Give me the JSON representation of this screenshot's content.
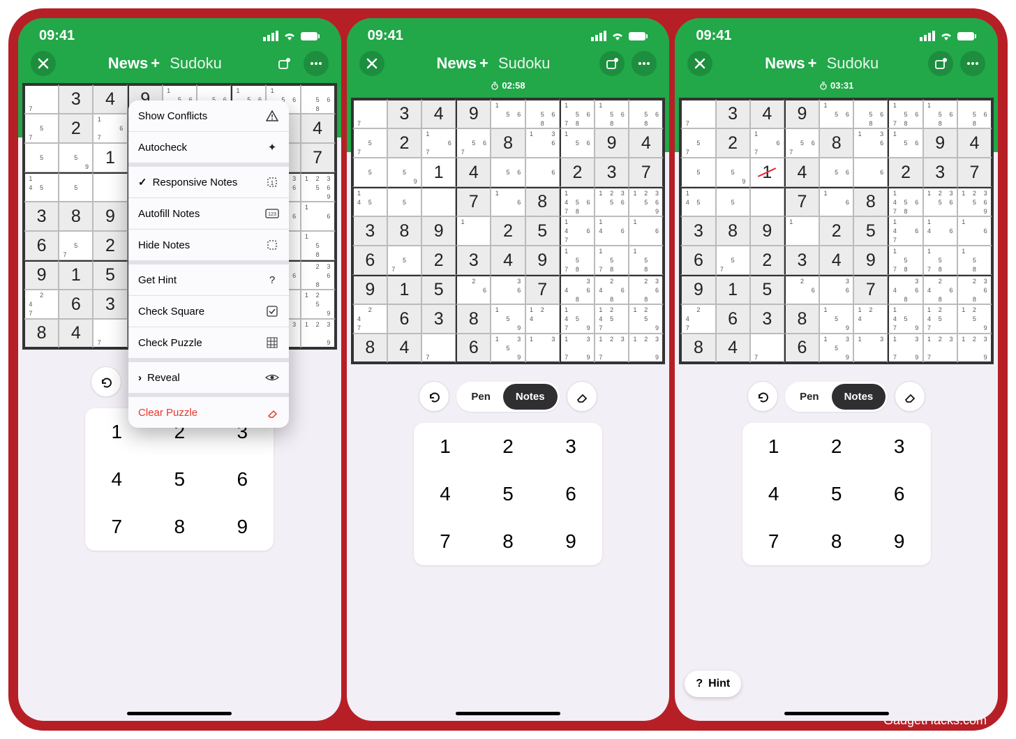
{
  "watermark": "GadgetHacks.com",
  "statusbar": {
    "time": "09:41"
  },
  "app_title": {
    "logo": "",
    "brand": "News",
    "plus": "+",
    "sub": "Sudoku"
  },
  "timers": {
    "s2": "02:58",
    "s3": "03:31"
  },
  "menu": {
    "show_conflicts": "Show Conflicts",
    "autocheck": "Autocheck",
    "responsive_notes": "Responsive Notes",
    "autofill_notes": "Autofill Notes",
    "hide_notes": "Hide Notes",
    "get_hint": "Get Hint",
    "check_square": "Check Square",
    "check_puzzle": "Check Puzzle",
    "reveal": "Reveal",
    "clear_puzzle": "Clear Puzzle"
  },
  "tools": {
    "pen": "Pen",
    "notes": "Notes"
  },
  "hint": {
    "label": "Hint",
    "icon": "?"
  },
  "keypad": [
    "1",
    "2",
    "3",
    "4",
    "5",
    "6",
    "7",
    "8",
    "9"
  ],
  "sudoku": {
    "comment": "Shared puzzle state across all three screenshots. v=given/entered value, g=grey(given), n=pencil notes list",
    "grid": [
      [
        {
          "n": [
            7
          ]
        },
        {
          "v": "3",
          "g": 1
        },
        {
          "v": "4",
          "g": 1
        },
        {
          "v": "9",
          "g": 1
        },
        {
          "n": [
            1,
            5,
            6
          ],
          "tr": [
            5,
            6
          ]
        },
        {
          "n": [
            8,
            5,
            6
          ]
        },
        {
          "n": [
            1,
            5,
            6,
            7,
            8
          ]
        },
        {
          "n": [
            1,
            5,
            6,
            8
          ]
        },
        {
          "n": [
            5,
            6,
            8
          ]
        }
      ],
      [
        {
          "n": [
            5,
            7
          ]
        },
        {
          "v": "2",
          "g": 1
        },
        {
          "n": [
            1,
            6,
            7
          ]
        },
        {
          "n": [
            5,
            6,
            7
          ]
        },
        {
          "v": "8",
          "g": 1
        },
        {
          "n": [
            1,
            3,
            6
          ]
        },
        {
          "n": [
            1,
            5,
            6
          ]
        },
        {
          "v": "9",
          "g": 1
        },
        {
          "v": "4",
          "g": 1
        }
      ],
      [
        {
          "n": [
            5
          ]
        },
        {
          "n": [
            5,
            9
          ]
        },
        {
          "v": "1",
          "redx_in_s3": true
        },
        {
          "v": "4",
          "g": 1
        },
        {
          "n": [
            5,
            6
          ]
        },
        {
          "n": [
            6
          ]
        },
        {
          "v": "2",
          "g": 1
        },
        {
          "v": "3",
          "g": 1
        },
        {
          "v": "7",
          "g": 1
        }
      ],
      [
        {
          "n": [
            1,
            4,
            5
          ]
        },
        {
          "n": [
            5
          ]
        },
        {
          "n": []
        },
        {
          "v": "7",
          "g": 1
        },
        {
          "n": [
            1,
            6
          ]
        },
        {
          "v": "8",
          "g": 1
        },
        {
          "n": [
            1,
            4,
            5,
            6,
            7,
            8
          ]
        },
        {
          "n": [
            1,
            2,
            3,
            5,
            6
          ]
        },
        {
          "n": [
            1,
            2,
            3,
            5,
            6,
            9
          ]
        }
      ],
      [
        {
          "v": "3",
          "g": 1
        },
        {
          "v": "8",
          "g": 1
        },
        {
          "v": "9",
          "g": 1
        },
        {
          "n": [
            1
          ]
        },
        {
          "v": "2",
          "g": 1
        },
        {
          "v": "5",
          "g": 1
        },
        {
          "n": [
            1,
            4,
            6,
            7
          ]
        },
        {
          "n": [
            1,
            4,
            6
          ]
        },
        {
          "n": [
            1,
            6
          ]
        }
      ],
      [
        {
          "v": "6",
          "g": 1
        },
        {
          "n": [
            5,
            7
          ]
        },
        {
          "v": "2",
          "g": 1
        },
        {
          "v": "3",
          "g": 1
        },
        {
          "v": "4",
          "g": 1
        },
        {
          "v": "9",
          "g": 1
        },
        {
          "n": [
            1,
            5,
            7,
            8
          ]
        },
        {
          "n": [
            1,
            5,
            7,
            8
          ]
        },
        {
          "n": [
            1,
            5,
            8
          ]
        }
      ],
      [
        {
          "v": "9",
          "g": 1
        },
        {
          "v": "1",
          "g": 1
        },
        {
          "v": "5",
          "g": 1
        },
        {
          "n": [
            2,
            6
          ]
        },
        {
          "n": [
            3,
            6
          ]
        },
        {
          "v": "7",
          "g": 1
        },
        {
          "n": [
            3,
            4,
            6,
            8
          ]
        },
        {
          "n": [
            2,
            4,
            6,
            8
          ]
        },
        {
          "n": [
            2,
            3,
            6,
            8
          ]
        }
      ],
      [
        {
          "n": [
            2,
            4,
            7
          ]
        },
        {
          "v": "6",
          "g": 1
        },
        {
          "v": "3",
          "g": 1
        },
        {
          "v": "8",
          "g": 1
        },
        {
          "n": [
            1,
            5,
            9
          ]
        },
        {
          "n": [
            1,
            2,
            4
          ]
        },
        {
          "n": [
            1,
            4,
            5,
            7,
            9
          ]
        },
        {
          "n": [
            1,
            2,
            4,
            5,
            7
          ]
        },
        {
          "n": [
            1,
            2,
            5,
            9
          ]
        }
      ],
      [
        {
          "v": "8",
          "g": 1
        },
        {
          "v": "4",
          "g": 1
        },
        {
          "n": [
            7
          ]
        },
        {
          "v": "6",
          "g": 1
        },
        {
          "n": [
            1,
            3,
            5,
            9
          ]
        },
        {
          "n": [
            1,
            3
          ]
        },
        {
          "n": [
            1,
            3,
            7,
            9
          ]
        },
        {
          "n": [
            1,
            2,
            3,
            7
          ]
        },
        {
          "n": [
            1,
            2,
            3,
            9
          ]
        }
      ]
    ]
  }
}
